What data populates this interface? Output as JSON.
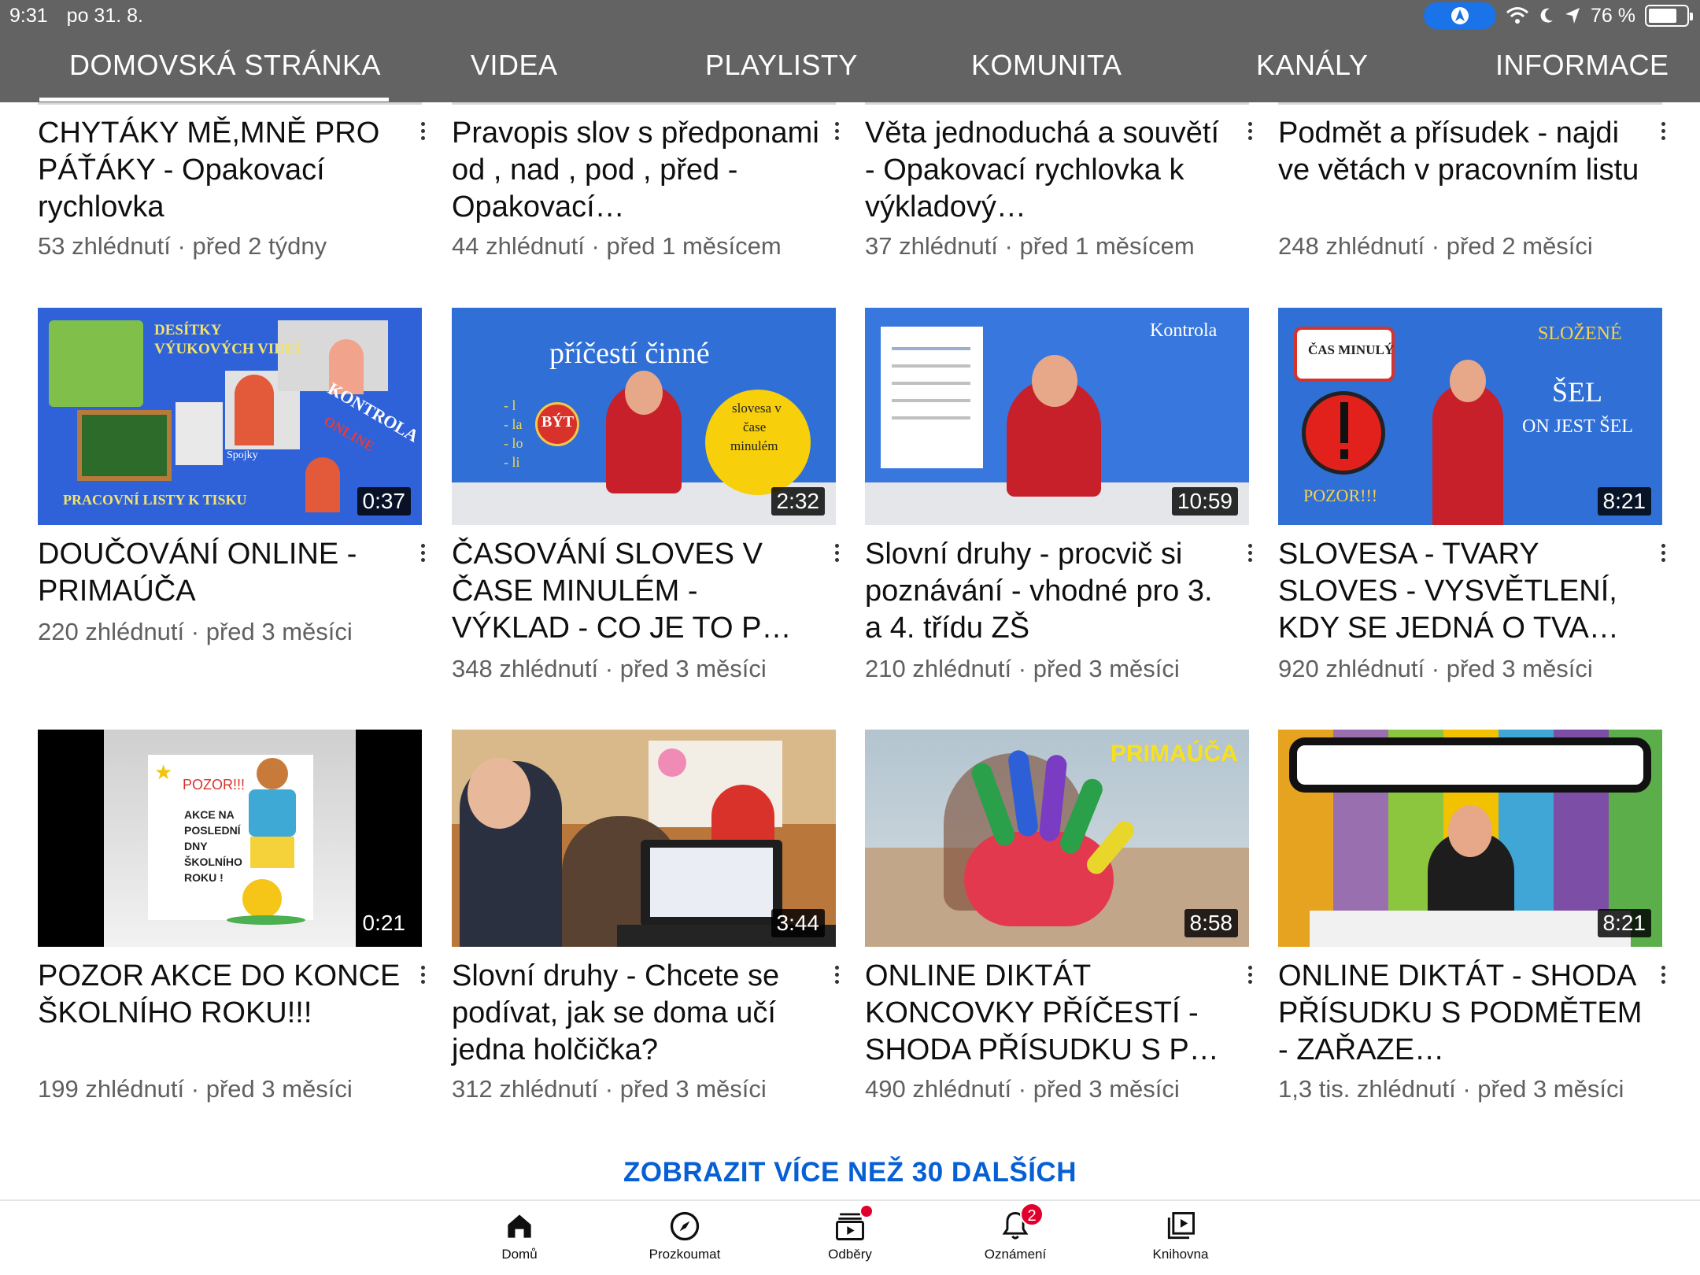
{
  "status_bar": {
    "time": "9:31",
    "date": "po 31. 8.",
    "battery": "76 %",
    "battery_level": 0.76
  },
  "tabs": [
    {
      "label": "DOMOVSKÁ STRÁNKA",
      "selected": true
    },
    {
      "label": "VIDEA"
    },
    {
      "label": "PLAYLISTY"
    },
    {
      "label": "KOMUNITA"
    },
    {
      "label": "KANÁLY"
    },
    {
      "label": "INFORMACE"
    }
  ],
  "videos": [
    {
      "title": "CHYTÁKY MĚ,MNĚ PRO PÁŤÁKY - Opakovací rychlovka",
      "meta": "53 zhlédnutí · před 2 týdny"
    },
    {
      "title": "Pravopis slov s předponami od , nad , pod , před - Opakovací…",
      "meta": "44 zhlédnutí · před 1 měsícem"
    },
    {
      "title": "Věta jednoduchá a souvětí - Opakovací rychlovka k výkladový…",
      "meta": "37 zhlédnutí · před 1 měsícem"
    },
    {
      "title": "Podmět a přísudek - najdi ve větách v pracovním listu",
      "meta": "248 zhlédnutí · před 2 měsíci"
    },
    {
      "title": "DOUČOVÁNÍ ONLINE - PRIMAÚČA",
      "meta": "220 zhlédnutí · před 3 měsíci",
      "duration": "0:37",
      "thumb_text": [
        "DESÍTKY",
        "VÝUKOVÝCH VIDEÍ",
        "KONTROLA",
        "ONLINE",
        "PRACOVNÍ LISTY K TISKU",
        "Spojky"
      ]
    },
    {
      "title": "ČASOVÁNÍ SLOVES V ČASE MINULÉM - VÝKLAD - CO JE TO P…",
      "meta": "348 zhlédnutí · před 3 měsíci",
      "duration": "2:32",
      "thumb_text": [
        "příčestí činné",
        "BÝT",
        "- l",
        "- la",
        "- lo",
        "- li",
        "slovesa v",
        "čase",
        "minulém"
      ]
    },
    {
      "title": "Slovní druhy - procvič si poznávání - vhodné pro 3. a 4. třídu ZŠ",
      "meta": "210 zhlédnutí · před 3 měsíci",
      "duration": "10:59",
      "thumb_text": [
        "Kontrola"
      ]
    },
    {
      "title": "SLOVESA - TVARY SLOVES - VYSVĚTLENÍ, KDY SE JEDNÁ O TVA…",
      "meta": "920 zhlédnutí · před 3 měsíci",
      "duration": "8:21",
      "thumb_text": [
        "ČAS MINULÝ",
        "SLOŽENÉ",
        "ŠEL",
        "ON JEST ŠEL",
        "POZOR!!!"
      ]
    },
    {
      "title": "POZOR AKCE DO KONCE ŠKOLNÍHO ROKU!!!",
      "meta": "199 zhlédnutí · před 3 měsíci",
      "duration": "0:21",
      "thumb_text": [
        "POZOR!!!",
        "AKCE NA",
        "POSLEDNÍ",
        "DNY",
        "ŠKOLNÍHO",
        "ROKU !"
      ]
    },
    {
      "title": "Slovní druhy - Chcete se podívat, jak se doma učí jedna holčička?",
      "meta": "312 zhlédnutí · před 3 měsíci",
      "duration": "3:44"
    },
    {
      "title": "ONLINE DIKTÁT KONCOVKY PŘÍČESTÍ - SHODA PŘÍSUDKU S P…",
      "meta": "490 zhlédnutí · před 3 měsíci",
      "duration": "8:58",
      "thumb_text": [
        "PRIMAÚČA"
      ]
    },
    {
      "title": "ONLINE DIKTÁT - SHODA PŘÍSUDKU S PODMĚTEM - ZAŘAZE…",
      "meta": "1,3 tis. zhlédnutí · před 3 měsíci",
      "duration": "8:21"
    }
  ],
  "show_more": "ZOBRAZIT VÍCE NEŽ 30 DALŠÍCH",
  "bottom_nav": [
    {
      "label": "Domů",
      "icon": "home-icon"
    },
    {
      "label": "Prozkoumat",
      "icon": "compass-icon"
    },
    {
      "label": "Odběry",
      "icon": "subscriptions-icon"
    },
    {
      "label": "Oznámení",
      "icon": "bell-icon",
      "badge": "2"
    },
    {
      "label": "Knihovna",
      "icon": "library-icon"
    }
  ],
  "colors": {
    "header_bg": "#636363",
    "link_blue": "#065fd4",
    "badge_red": "#e1002d",
    "thumb_blue": "#2f6fd6"
  }
}
